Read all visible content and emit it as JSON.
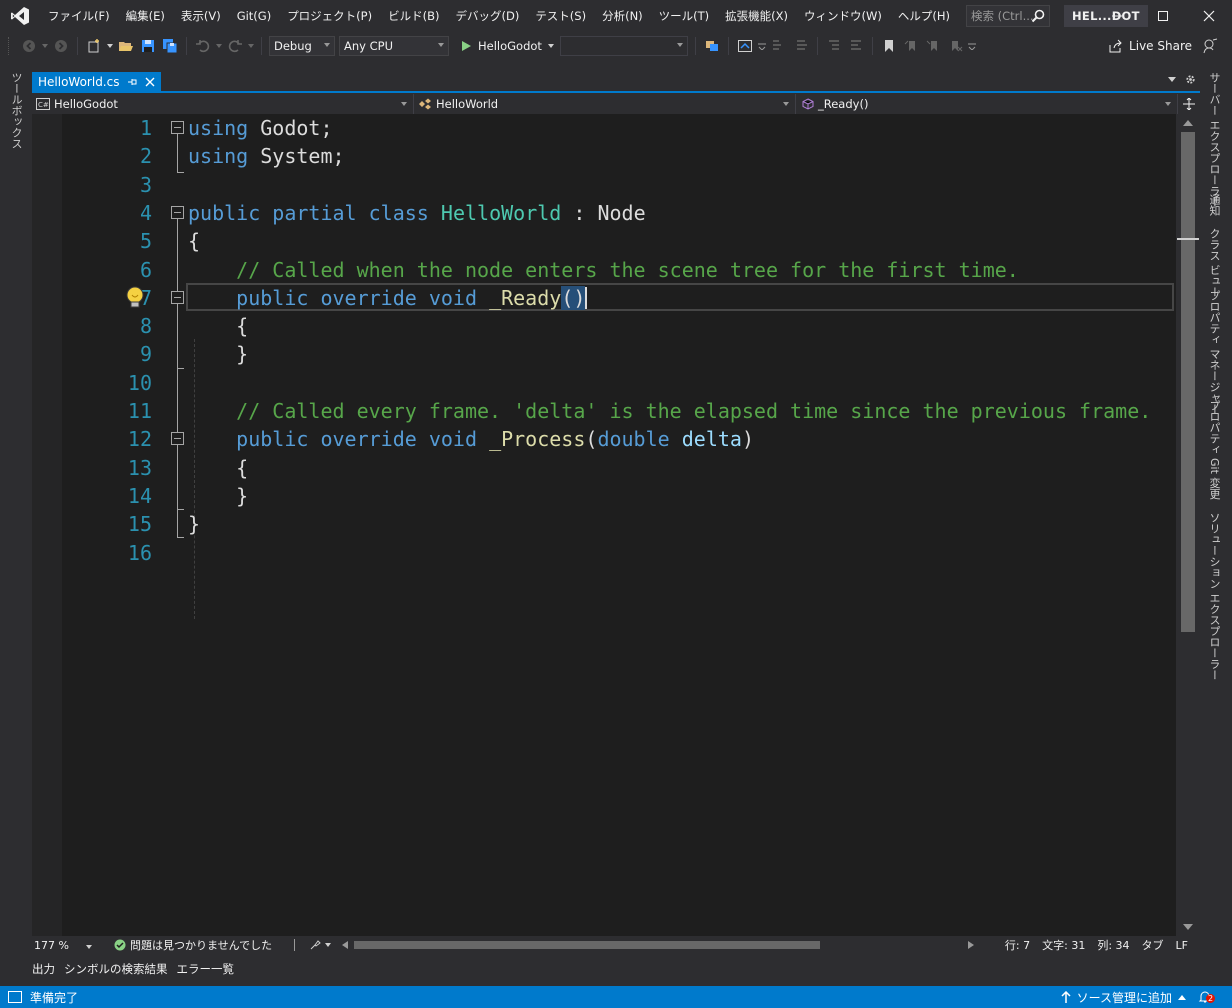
{
  "menubar": {
    "items": [
      "ファイル(F)",
      "編集(E)",
      "表示(V)",
      "Git(G)",
      "プロジェクト(P)",
      "ビルド(B)",
      "デバッグ(D)",
      "テスト(S)",
      "分析(N)",
      "ツール(T)",
      "拡張機能(X)",
      "ウィンドウ(W)",
      "ヘルプ(H)"
    ],
    "search_placeholder": "検索 (Ctrl...",
    "solution_name": "HEL...DOT"
  },
  "toolbar": {
    "configuration": "Debug",
    "platform": "Any CPU",
    "run_target": "HelloGodot",
    "live_share": "Live Share"
  },
  "left_strip": {
    "toolbox": "ツールボックス"
  },
  "right_strip": {
    "tabs": [
      "サーバー エクスプローラー",
      "通知",
      "クラス ビュー",
      "プロパティ マネージャー",
      "プロパティ",
      "Git 変更",
      "ソリューション エクスプローラー"
    ]
  },
  "document": {
    "tab_title": "HelloWorld.cs",
    "nav_project": "HelloGodot",
    "nav_type": "HelloWorld",
    "nav_member": "_Ready()"
  },
  "editor": {
    "lines": [
      {
        "n": "1",
        "tokens": [
          [
            "kw",
            "using"
          ],
          [
            "",
            ""
          ],
          [
            "",
            " Godot;"
          ]
        ]
      },
      {
        "n": "2",
        "tokens": [
          [
            "kw",
            "using"
          ],
          [
            "",
            " System;"
          ]
        ]
      },
      {
        "n": "3",
        "tokens": []
      },
      {
        "n": "4",
        "tokens": [
          [
            "kw",
            "public"
          ],
          [
            "",
            " "
          ],
          [
            "kw",
            "partial"
          ],
          [
            "",
            " "
          ],
          [
            "kw",
            "class"
          ],
          [
            "",
            " "
          ],
          [
            "ty",
            "HelloWorld"
          ],
          [
            "",
            " : Node"
          ]
        ]
      },
      {
        "n": "5",
        "tokens": [
          [
            "",
            "{"
          ]
        ]
      },
      {
        "n": "6",
        "tokens": [
          [
            "",
            "    "
          ],
          [
            "cm",
            "// Called when the node enters the scene tree for the first time."
          ]
        ]
      },
      {
        "n": "7",
        "tokens": [
          [
            "",
            "    "
          ],
          [
            "kw",
            "public"
          ],
          [
            "",
            " "
          ],
          [
            "kw",
            "override"
          ],
          [
            "",
            " "
          ],
          [
            "kw",
            "void"
          ],
          [
            "",
            " "
          ],
          [
            "mt",
            "_Ready"
          ],
          [
            "hl",
            "()"
          ]
        ]
      },
      {
        "n": "8",
        "tokens": [
          [
            "",
            "    {"
          ]
        ]
      },
      {
        "n": "9",
        "tokens": [
          [
            "",
            "    }"
          ]
        ]
      },
      {
        "n": "10",
        "tokens": []
      },
      {
        "n": "11",
        "tokens": [
          [
            "",
            "    "
          ],
          [
            "cm",
            "// Called every frame. 'delta' is the elapsed time since the previous frame."
          ]
        ]
      },
      {
        "n": "12",
        "tokens": [
          [
            "",
            "    "
          ],
          [
            "kw",
            "public"
          ],
          [
            "",
            " "
          ],
          [
            "kw",
            "override"
          ],
          [
            "",
            " "
          ],
          [
            "kw",
            "void"
          ],
          [
            "",
            " "
          ],
          [
            "mt",
            "_Process"
          ],
          [
            "",
            "("
          ],
          [
            "kw",
            "double"
          ],
          [
            "",
            " "
          ],
          [
            "pm",
            "delta"
          ],
          [
            "",
            ")"
          ]
        ]
      },
      {
        "n": "13",
        "tokens": [
          [
            "",
            "    {"
          ]
        ]
      },
      {
        "n": "14",
        "tokens": [
          [
            "",
            "    }"
          ]
        ]
      },
      {
        "n": "15",
        "tokens": [
          [
            "",
            "}"
          ]
        ]
      },
      {
        "n": "16",
        "tokens": []
      }
    ]
  },
  "editor_bottom": {
    "zoom": "177 %",
    "issues": "問題は見つかりませんでした",
    "line": "行: 7",
    "char": "文字: 31",
    "col": "列: 34",
    "indent": "タブ",
    "eol": "LF"
  },
  "bottom_tabs": [
    "出力",
    "シンボルの検索結果",
    "エラー一覧"
  ],
  "statusbar": {
    "ready": "準備完了",
    "source_control": "ソース管理に追加",
    "notifications": "2"
  },
  "colors": {
    "accent": "#007acc",
    "keyword": "#569cd6",
    "type": "#4ec9b0",
    "comment": "#57a64a",
    "method": "#dcdcaa",
    "line_number": "#2b91af"
  }
}
